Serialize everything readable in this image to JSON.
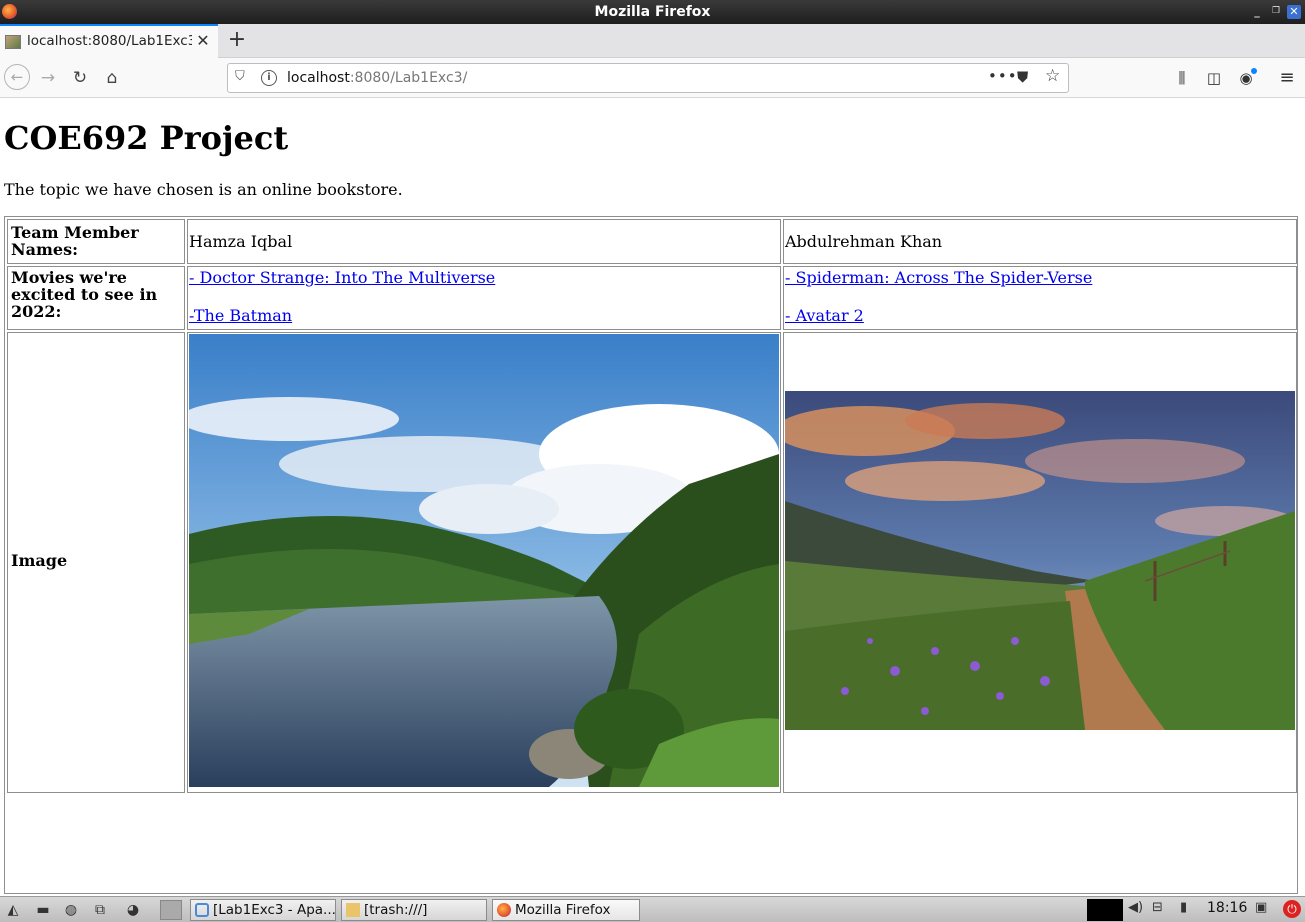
{
  "window": {
    "title": "Mozilla Firefox"
  },
  "browser": {
    "tab_title": "localhost:8080/Lab1Exc3/",
    "url_host": "localhost",
    "url_path": ":8080/Lab1Exc3/"
  },
  "page": {
    "heading": "COE692 Project",
    "intro": "The topic we have chosen is an online bookstore.",
    "table": {
      "row_team_label": "Team Member Names:",
      "member1": "Hamza Iqbal",
      "member2": "Abdulrehman Khan",
      "row_movies_label": "Movies we're excited to see in 2022:",
      "movies1": [
        "- Doctor Strange: Into The Multiverse",
        "-The Batman"
      ],
      "movies2": [
        "- Spiderman: Across The Spider-Verse",
        "- Avatar 2"
      ],
      "row_image_label": "Image"
    }
  },
  "taskbar": {
    "tasks": [
      "[Lab1Exc3 - Apa...",
      "[trash:///]",
      "Mozilla Firefox"
    ],
    "clock": "18:16"
  },
  "colors": {
    "accent": "#0a84ff",
    "link": "#0000ee"
  }
}
